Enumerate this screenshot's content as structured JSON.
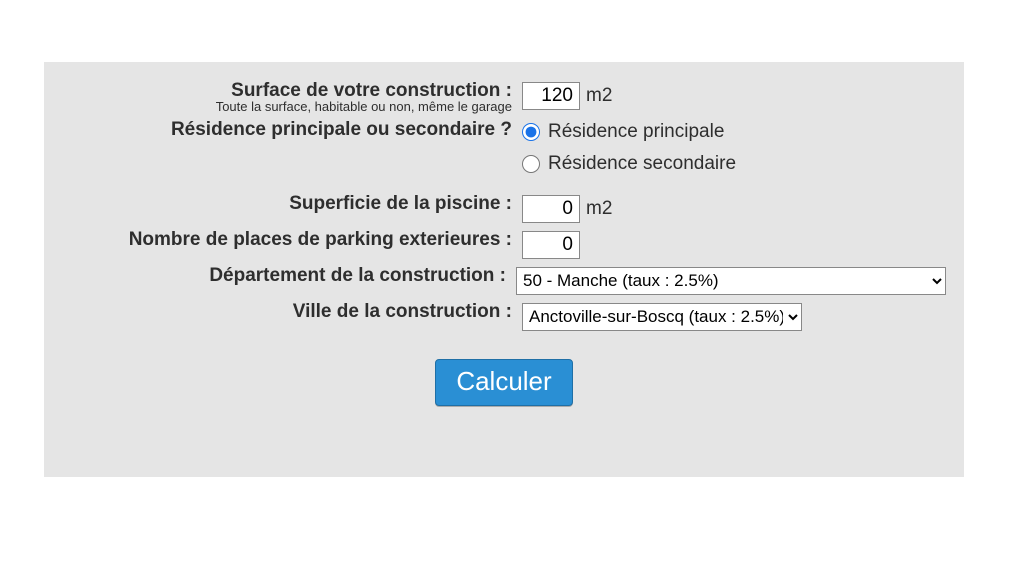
{
  "surface": {
    "label": "Surface de votre construction :",
    "sublabel": "Toute la surface, habitable ou non, même le garage",
    "value": "120",
    "unit": "m2"
  },
  "residence": {
    "label": "Résidence principale ou secondaire ?",
    "selected": "principale",
    "options": {
      "principale": "Résidence principale",
      "secondaire": "Résidence secondaire"
    }
  },
  "piscine": {
    "label": "Superficie de la piscine :",
    "value": "0",
    "unit": "m2"
  },
  "parking": {
    "label": "Nombre de places de parking exterieures :",
    "value": "0"
  },
  "departement": {
    "label": "Département de la construction :",
    "selected": "50 - Manche (taux : 2.5%)"
  },
  "ville": {
    "label": "Ville de la construction :",
    "selected": "Anctoville-sur-Boscq (taux : 2.5%)"
  },
  "button": {
    "label": "Calculer"
  }
}
